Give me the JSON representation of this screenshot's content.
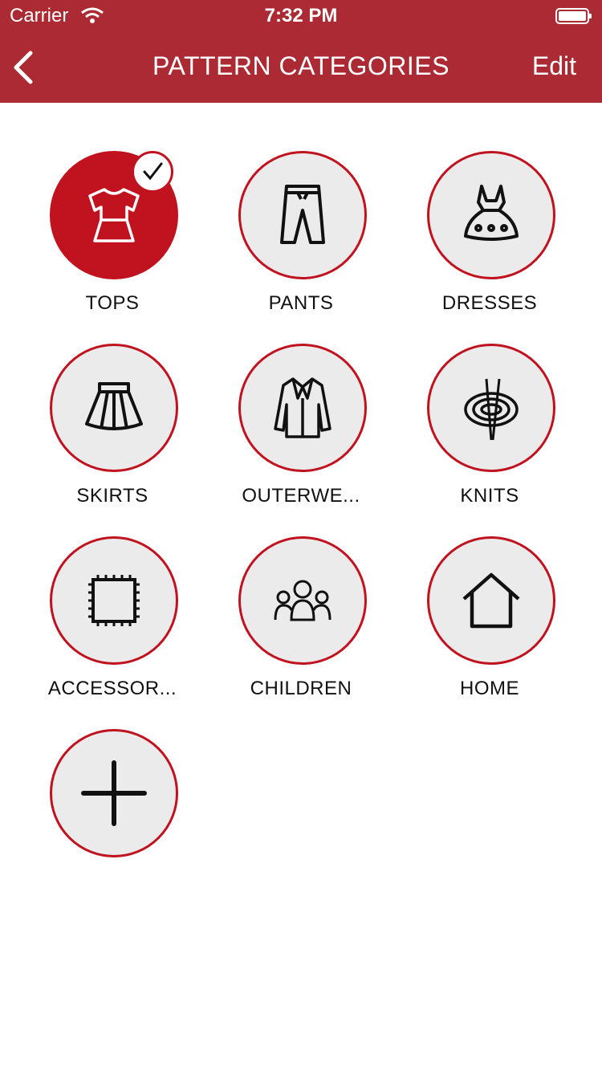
{
  "status_bar": {
    "carrier": "Carrier",
    "time": "7:32 PM"
  },
  "nav": {
    "title": "PATTERN CATEGORIES",
    "edit_label": "Edit"
  },
  "categories": [
    {
      "label": "TOPS",
      "icon": "shirt-icon",
      "selected": true
    },
    {
      "label": "PANTS",
      "icon": "pants-icon",
      "selected": false
    },
    {
      "label": "DRESSES",
      "icon": "dress-icon",
      "selected": false
    },
    {
      "label": "SKIRTS",
      "icon": "skirt-icon",
      "selected": false
    },
    {
      "label": "OUTERWE...",
      "icon": "jacket-icon",
      "selected": false
    },
    {
      "label": "KNITS",
      "icon": "yarn-icon",
      "selected": false
    },
    {
      "label": "ACCESSOR...",
      "icon": "patch-icon",
      "selected": false
    },
    {
      "label": "CHILDREN",
      "icon": "children-icon",
      "selected": false
    },
    {
      "label": "HOME",
      "icon": "house-icon",
      "selected": false
    },
    {
      "label": "",
      "icon": "plus-icon",
      "selected": false
    }
  ],
  "colors": {
    "nav_bar": "#ac2a33",
    "accent": "#c0121f",
    "circle_fill": "#ebebeb"
  }
}
